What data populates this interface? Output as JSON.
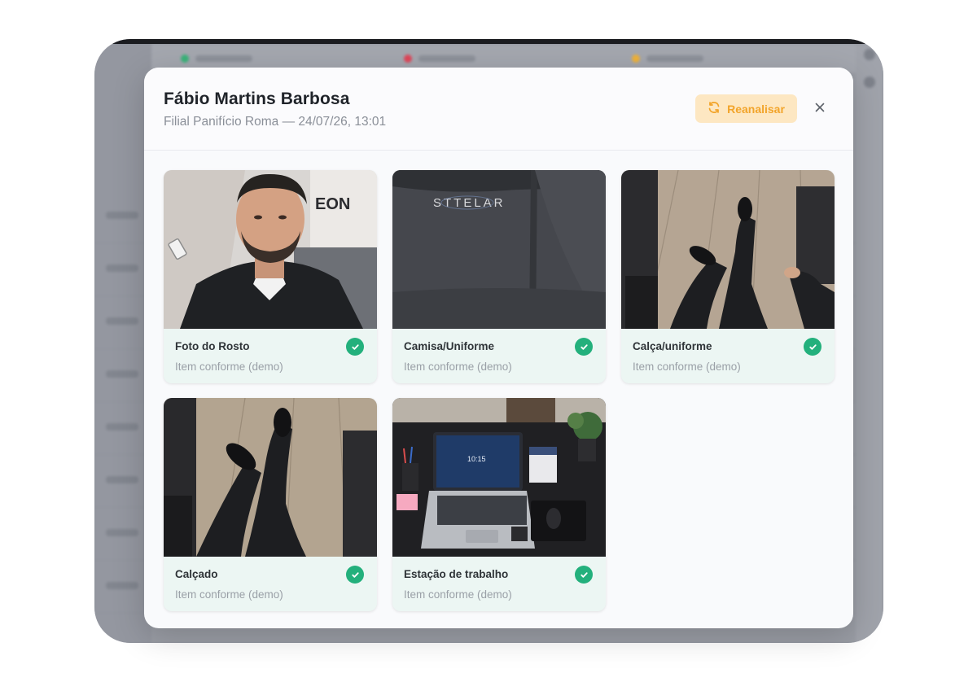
{
  "modal": {
    "title": "Fábio Martins Barbosa",
    "subtitle": "Filial Panifício Roma — 24/07/26, 13:01",
    "reanalyze_label": "Reanalisar",
    "close_icon": "close-icon",
    "reanalyze_icon": "refresh-icon"
  },
  "photos": [
    {
      "label": "Foto do Rosto",
      "status": "Item conforme (demo)",
      "icon": "check-icon"
    },
    {
      "label": "Camisa/Uniforme",
      "status": "Item conforme (demo)",
      "icon": "check-icon"
    },
    {
      "label": "Calça/uniforme",
      "status": "Item conforme (demo)",
      "icon": "check-icon"
    },
    {
      "label": "Calçado",
      "status": "Item conforme (demo)",
      "icon": "check-icon"
    },
    {
      "label": "Estação de trabalho",
      "status": "Item conforme (demo)",
      "icon": "check-icon"
    }
  ],
  "photo_text": {
    "shirt_brand": "STTELAR",
    "wall_logo": "EON",
    "laptop_clock": "10:15"
  },
  "colors": {
    "accent_warning_bg": "#fde7c2",
    "accent_warning_text": "#f2a42a",
    "success": "#23b07c",
    "card_bg": "#ecf6f3"
  }
}
